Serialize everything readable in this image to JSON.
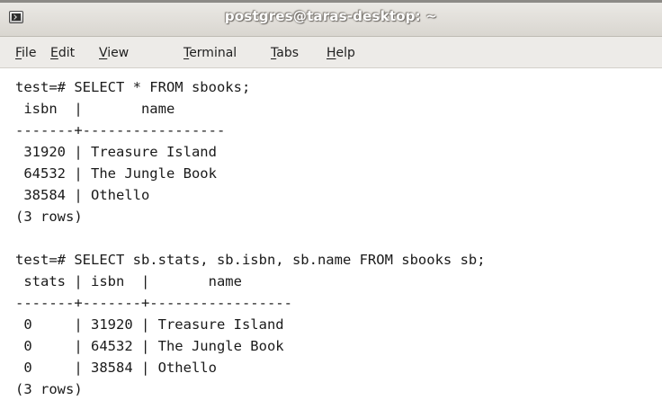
{
  "window": {
    "title": "postgres@taras-desktop: ~",
    "icon": "terminal-icon"
  },
  "menu": {
    "items": [
      {
        "label": "File",
        "mnemonic": "F",
        "rest": "ile"
      },
      {
        "label": "Edit",
        "mnemonic": "E",
        "rest": "dit"
      },
      {
        "label": "View",
        "mnemonic": "V",
        "rest": "iew"
      },
      {
        "label": "Terminal",
        "mnemonic": "T",
        "rest": "erminal"
      },
      {
        "label": "Tabs",
        "mnemonic": "T",
        "rest": "abs"
      },
      {
        "label": "Help",
        "mnemonic": "H",
        "rest": "elp"
      }
    ]
  },
  "terminal": {
    "lines": [
      "test=# SELECT * FROM sbooks;",
      " isbn  |       name",
      "-------+-----------------",
      " 31920 | Treasure Island",
      " 64532 | The Jungle Book",
      " 38584 | Othello",
      "(3 rows)",
      "",
      "test=# SELECT sb.stats, sb.isbn, sb.name FROM sbooks sb;",
      " stats | isbn  |       name",
      "-------+-------+-----------------",
      " 0     | 31920 | Treasure Island",
      " 0     | 64532 | The Jungle Book",
      " 0     | 38584 | Othello",
      "(3 rows)"
    ]
  }
}
